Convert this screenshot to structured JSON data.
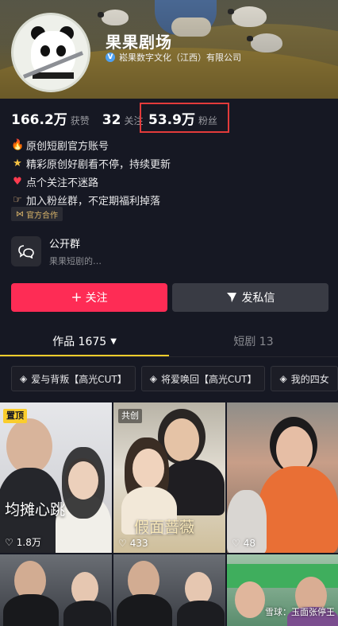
{
  "profile": {
    "name": "果果剧场",
    "verify_text": "崧果数字文化（江西）有限公司"
  },
  "stats": {
    "likes_num": "166.2万",
    "likes_label": "获赞",
    "following_num": "32",
    "following_label": "关注",
    "fans_num": "53.9万",
    "fans_label": "粉丝"
  },
  "bio": {
    "line1": "原创短剧官方账号",
    "line2": "精彩原创好剧看不停，持续更新",
    "line3": "点个关注不迷路",
    "line4": "加入粉丝群，不定期福利掉落",
    "icons": [
      "fire-icon",
      "star-icon",
      "heart-icon",
      "pointing-hand-icon"
    ],
    "coop_label": "官方合作"
  },
  "group": {
    "title": "公开群",
    "subtitle": "果果短剧的…"
  },
  "actions": {
    "follow_label": "关注",
    "message_label": "发私信",
    "follow_color": "#fe2c55"
  },
  "tabs": {
    "works_label": "作品 1675",
    "shortdrama_label": "短剧 13",
    "active_color": "#facd2c"
  },
  "collections": [
    {
      "label": "爱与背叛【高光CUT】"
    },
    {
      "label": "将爱唤回【高光CUT】"
    },
    {
      "label": "我的四女"
    }
  ],
  "videos": [
    {
      "badge": "置顶",
      "likes": "1.8万",
      "title_text": "均摊心跳"
    },
    {
      "badge": "共创",
      "likes": "433",
      "title_text": "假面蔷薇"
    },
    {
      "likes": "48"
    },
    {},
    {},
    {
      "watermark": "雪球：玉面张停王"
    }
  ]
}
